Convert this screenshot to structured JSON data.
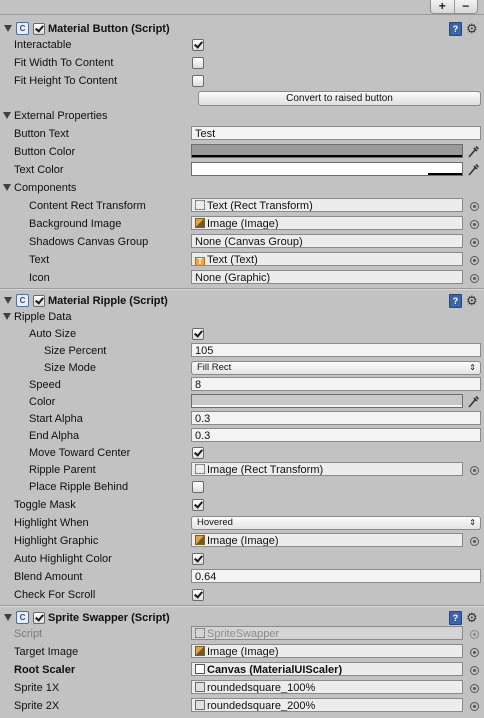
{
  "toolbar": {
    "add": "+",
    "remove": "−"
  },
  "icons": {
    "component": "C",
    "help": "?",
    "settings": "⚙",
    "picker": "⊙",
    "dropdown_arrow": "⇕"
  },
  "colors": {
    "button_color": "#9a9a9a",
    "text_color": "#ffffff",
    "ripple_color": "#c8c8c8"
  },
  "material_button": {
    "title": "Material Button (Script)",
    "enabled": true,
    "interactable": {
      "label": "Interactable",
      "value": true
    },
    "fit_width": {
      "label": "Fit Width To Content",
      "value": false
    },
    "fit_height": {
      "label": "Fit Height To Content",
      "value": false
    },
    "convert_button": "Convert to raised button",
    "external": {
      "label": "External Properties",
      "button_text": {
        "label": "Button Text",
        "value": "Test"
      },
      "button_color": {
        "label": "Button Color"
      },
      "text_color": {
        "label": "Text Color"
      }
    },
    "components": {
      "label": "Components",
      "content_rect": {
        "label": "Content Rect Transform",
        "value": "Text (Rect Transform)"
      },
      "background_image": {
        "label": "Background Image",
        "value": "Image (Image)"
      },
      "shadows_group": {
        "label": "Shadows Canvas Group",
        "value": "None (Canvas Group)"
      },
      "text": {
        "label": "Text",
        "value": "Text (Text)"
      },
      "icon": {
        "label": "Icon",
        "value": "None (Graphic)"
      }
    }
  },
  "material_ripple": {
    "title": "Material Ripple (Script)",
    "enabled": true,
    "ripple_data": {
      "label": "Ripple Data",
      "auto_size": {
        "label": "Auto Size",
        "value": true
      },
      "size_percent": {
        "label": "Size Percent",
        "value": "105"
      },
      "size_mode": {
        "label": "Size Mode",
        "value": "Fill Rect"
      },
      "speed": {
        "label": "Speed",
        "value": "8"
      },
      "color": {
        "label": "Color"
      },
      "start_alpha": {
        "label": "Start Alpha",
        "value": "0.3"
      },
      "end_alpha": {
        "label": "End Alpha",
        "value": "0.3"
      },
      "move_toward_center": {
        "label": "Move Toward Center",
        "value": true
      },
      "ripple_parent": {
        "label": "Ripple Parent",
        "value": "Image (Rect Transform)"
      },
      "place_behind": {
        "label": "Place Ripple Behind",
        "value": false
      }
    },
    "toggle_mask": {
      "label": "Toggle Mask",
      "value": true
    },
    "highlight_when": {
      "label": "Highlight When",
      "value": "Hovered"
    },
    "highlight_graphic": {
      "label": "Highlight Graphic",
      "value": "Image (Image)"
    },
    "auto_highlight_color": {
      "label": "Auto Highlight Color",
      "value": true
    },
    "blend_amount": {
      "label": "Blend Amount",
      "value": "0.64"
    },
    "check_for_scroll": {
      "label": "Check For Scroll",
      "value": true
    }
  },
  "sprite_swapper": {
    "title": "Sprite Swapper (Script)",
    "enabled": true,
    "script": {
      "label": "Script",
      "value": "SpriteSwapper"
    },
    "target_image": {
      "label": "Target Image",
      "value": "Image (Image)"
    },
    "root_scaler": {
      "label": "Root Scaler",
      "value": "Canvas (MaterialUIScaler)"
    },
    "sprite_1x": {
      "label": "Sprite 1X",
      "value": "roundedsquare_100%"
    },
    "sprite_2x": {
      "label": "Sprite 2X",
      "value": "roundedsquare_200%"
    }
  }
}
